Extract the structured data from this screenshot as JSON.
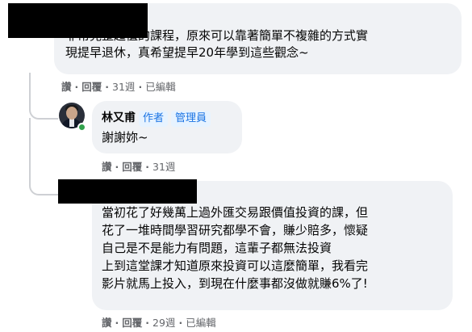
{
  "comments": [
    {
      "text": "非常完整超值的課程，原來可以靠著簡單不複雜的方式實\n現提早退休，真希望提早20年學到這些觀念~",
      "actions": {
        "like": "讚",
        "reply": "回覆",
        "time": "31週",
        "edited": "已編輯"
      }
    },
    {
      "author": "林又甫",
      "badges": [
        "作者",
        "管理員"
      ],
      "text": "謝謝妳~",
      "actions": {
        "like": "讚",
        "reply": "回覆",
        "time": "31週"
      }
    },
    {
      "text": "當初花了好幾萬上過外匯交易跟價值投資的課，但\n花了一堆時間學習研究都學不會，賺少賠多，懷疑\n自己是不是能力有問題，這輩子都無法投資\n上到這堂課才知道原來投資可以這麼簡單，我看完\n影片就馬上投入，到現在什麼事都沒做就賺6%了!",
      "actions": {
        "like": "讚",
        "reply": "回覆",
        "time": "29週",
        "edited": "已編輯"
      }
    }
  ],
  "colors": {
    "bubble": "#f0f2f5",
    "meta": "#65676b",
    "badge": "#1b74e4",
    "online": "#31a24c"
  },
  "separator": "·"
}
